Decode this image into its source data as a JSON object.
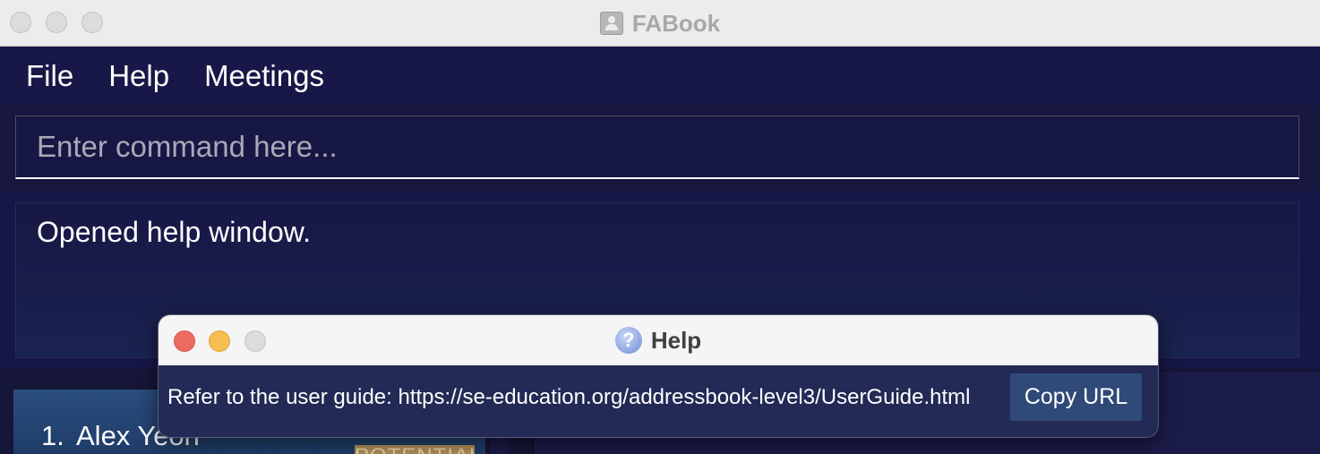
{
  "window": {
    "title": "FABook"
  },
  "menu": {
    "items": [
      "File",
      "Help",
      "Meetings"
    ]
  },
  "command": {
    "placeholder": "Enter command here...",
    "value": ""
  },
  "result": {
    "message": "Opened help window."
  },
  "person_list": {
    "items": [
      {
        "index": "1.",
        "name": "Alex Yeoh",
        "tag": "POTENTIAL"
      }
    ]
  },
  "help_dialog": {
    "title": "Help",
    "message": "Refer to the user guide: https://se-education.org/addressbook-level3/UserGuide.html",
    "copy_button_label": "Copy URL"
  },
  "colors": {
    "background": "#1b1b47",
    "titlebar": "#ececec",
    "help_body": "#222a55",
    "copy_button": "#2f4a78",
    "tag": "#b59257",
    "close_red": "#ed6a5e",
    "minimize_yellow": "#f5bf4f",
    "inactive_gray": "#dcdcdc"
  }
}
